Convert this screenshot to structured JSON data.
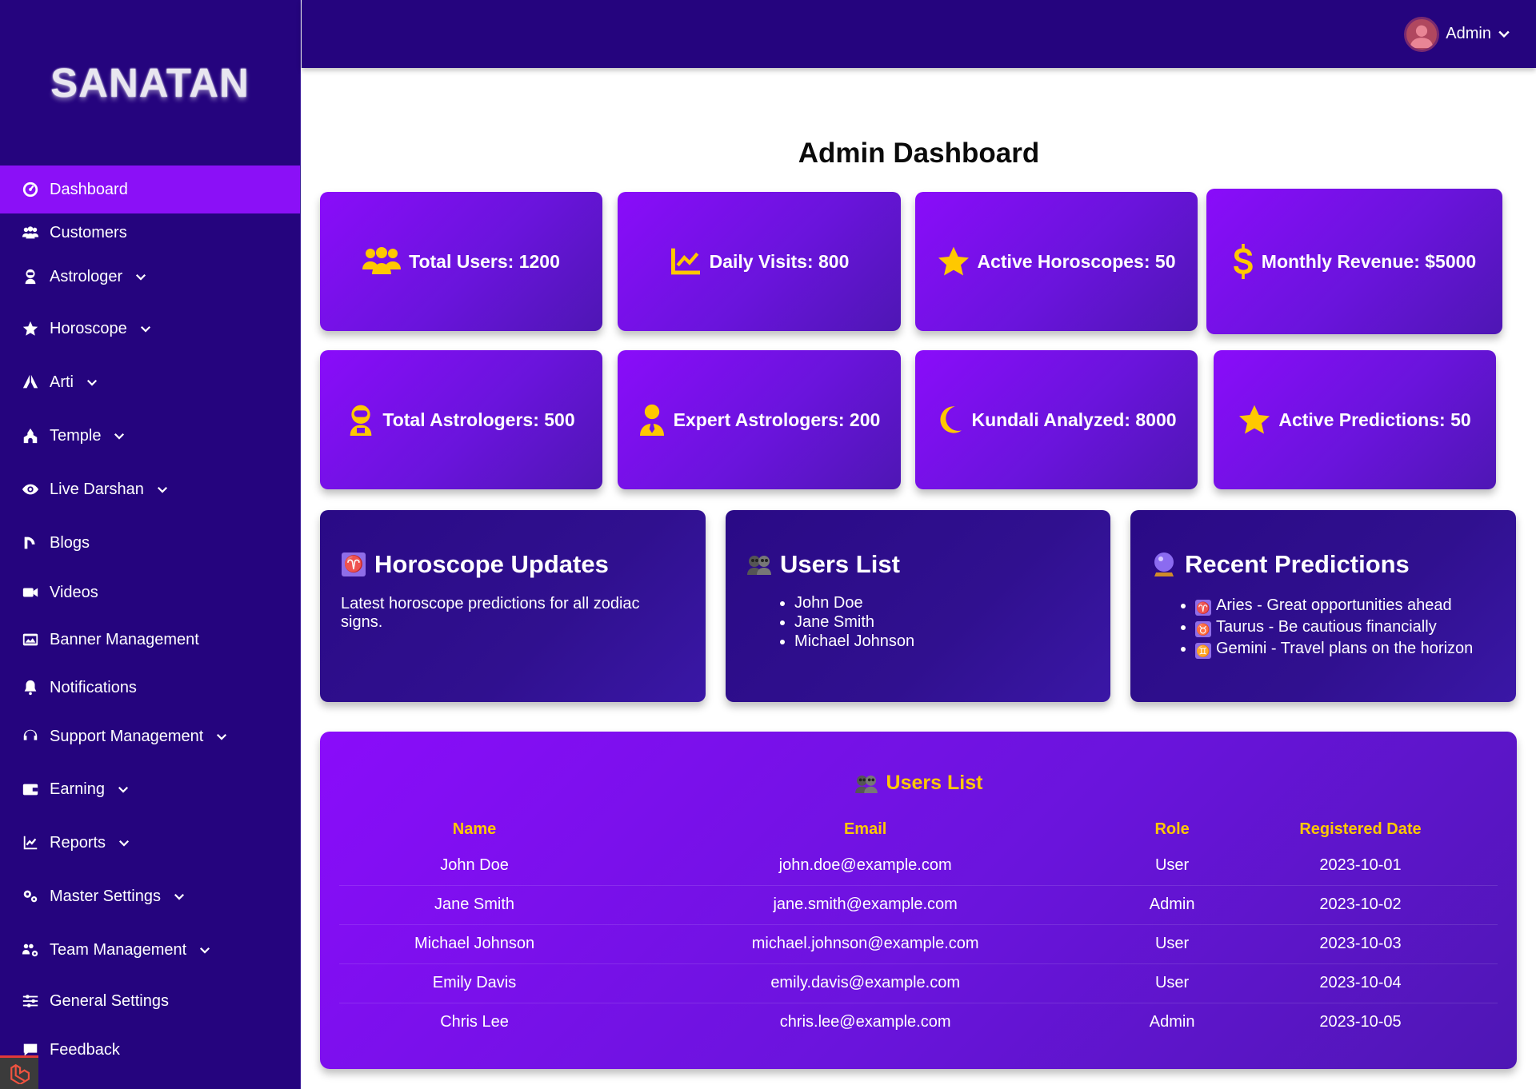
{
  "brand": {
    "name": "SANATAN"
  },
  "sidebar": {
    "items": [
      {
        "label": "Dashboard",
        "icon": "dashboard-gauge-icon",
        "has_submenu": false,
        "active": true
      },
      {
        "label": "Customers",
        "icon": "users-icon",
        "has_submenu": false
      },
      {
        "label": "Astrologer",
        "icon": "user-astronaut-icon",
        "has_submenu": true
      },
      {
        "label": "Horoscope",
        "icon": "star-icon",
        "has_submenu": true
      },
      {
        "label": "Arti",
        "icon": "praying-hands-icon",
        "has_submenu": true
      },
      {
        "label": "Temple",
        "icon": "place-of-worship-icon",
        "has_submenu": true
      },
      {
        "label": "Live Darshan",
        "icon": "eye-icon",
        "has_submenu": true
      },
      {
        "label": "Blogs",
        "icon": "blog-icon",
        "has_submenu": false
      },
      {
        "label": "Videos",
        "icon": "video-camera-icon",
        "has_submenu": false
      },
      {
        "label": "Banner Management",
        "icon": "images-icon",
        "has_submenu": false
      },
      {
        "label": "Notifications",
        "icon": "bell-icon",
        "has_submenu": false
      },
      {
        "label": "Support Management",
        "icon": "headset-icon",
        "has_submenu": true
      },
      {
        "label": "Earning",
        "icon": "wallet-icon",
        "has_submenu": true
      },
      {
        "label": "Reports",
        "icon": "chart-line-icon",
        "has_submenu": true
      },
      {
        "label": "Master Settings",
        "icon": "cogs-icon",
        "has_submenu": true
      },
      {
        "label": "Team Management",
        "icon": "users-cog-icon",
        "has_submenu": true
      },
      {
        "label": "General Settings",
        "icon": "sliders-icon",
        "has_submenu": false
      },
      {
        "label": "Feedback",
        "icon": "comment-icon",
        "has_submenu": false
      }
    ]
  },
  "header": {
    "user_name": "Admin"
  },
  "main": {
    "title": "Admin Dashboard",
    "stats": [
      {
        "label": "Total Users: 1200",
        "icon": "users-icon"
      },
      {
        "label": "Daily Visits: 800",
        "icon": "chart-line-icon"
      },
      {
        "label": "Active Horoscopes: 50",
        "icon": "star-icon"
      },
      {
        "label": "Monthly Revenue: $5000",
        "icon": "dollar-sign-icon"
      },
      {
        "label": "Total Astrologers: 500",
        "icon": "user-astronaut-icon"
      },
      {
        "label": "Expert Astrologers: 200",
        "icon": "user-tie-icon"
      },
      {
        "label": "Kundali Analyzed: 8000",
        "icon": "moon-icon"
      },
      {
        "label": "Active Predictions: 50",
        "icon": "star-icon"
      }
    ],
    "panels": {
      "horoscope": {
        "title": "Horoscope Updates",
        "text": "Latest horoscope predictions for all zodiac signs.",
        "icon": "aries-symbol-icon"
      },
      "users": {
        "title": "Users List",
        "icon": "two-people-icon",
        "items": [
          "John Doe",
          "Jane Smith",
          "Michael Johnson"
        ]
      },
      "predictions": {
        "title": "Recent Predictions",
        "icon": "crystal-ball-icon",
        "items": [
          {
            "symbol": "♈",
            "text": "Aries - Great opportunities ahead"
          },
          {
            "symbol": "♉",
            "text": "Taurus - Be cautious financially"
          },
          {
            "symbol": "♊",
            "text": "Gemini - Travel plans on the horizon"
          }
        ]
      }
    },
    "users_table": {
      "title": "Users List",
      "headers": [
        "Name",
        "Email",
        "Role",
        "Registered Date"
      ],
      "rows": [
        [
          "John Doe",
          "john.doe@example.com",
          "User",
          "2023-10-01"
        ],
        [
          "Jane Smith",
          "jane.smith@example.com",
          "Admin",
          "2023-10-02"
        ],
        [
          "Michael Johnson",
          "michael.johnson@example.com",
          "User",
          "2023-10-03"
        ],
        [
          "Emily Davis",
          "emily.davis@example.com",
          "User",
          "2023-10-04"
        ],
        [
          "Chris Lee",
          "chris.lee@example.com",
          "Admin",
          "2023-10-05"
        ]
      ]
    }
  },
  "colors": {
    "sidebar_bg": "#25047e",
    "active_item": "#8b10f7",
    "card_gradient_start": "#8a0cfa",
    "card_gradient_end": "#4e16b4",
    "accent_yellow": "#ffc800"
  }
}
